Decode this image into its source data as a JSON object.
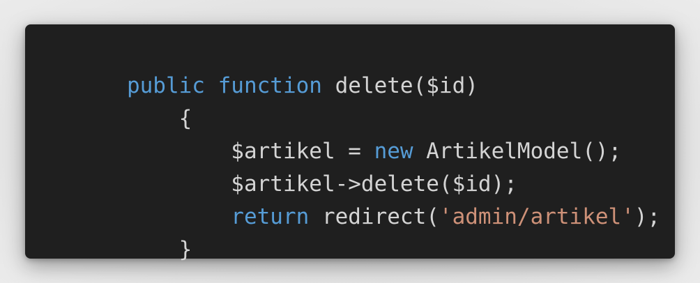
{
  "code": {
    "lines": [
      {
        "indent": "",
        "tokens": [
          {
            "text": "public",
            "type": "keyword"
          },
          {
            "text": " ",
            "type": "plain"
          },
          {
            "text": "function",
            "type": "keyword"
          },
          {
            "text": " delete($id)",
            "type": "plain"
          }
        ]
      },
      {
        "indent": "    ",
        "tokens": [
          {
            "text": "{",
            "type": "plain"
          }
        ]
      },
      {
        "indent": "        ",
        "tokens": [
          {
            "text": "$artikel = ",
            "type": "plain"
          },
          {
            "text": "new",
            "type": "keyword"
          },
          {
            "text": " ArtikelModel();",
            "type": "plain"
          }
        ]
      },
      {
        "indent": "        ",
        "tokens": [
          {
            "text": "$artikel->delete($id);",
            "type": "plain"
          }
        ]
      },
      {
        "indent": "        ",
        "tokens": [
          {
            "text": "return",
            "type": "keyword"
          },
          {
            "text": " redirect(",
            "type": "plain"
          },
          {
            "text": "'admin/artikel'",
            "type": "string"
          },
          {
            "text": ");",
            "type": "plain"
          }
        ]
      },
      {
        "indent": "    ",
        "tokens": [
          {
            "text": "}",
            "type": "plain"
          }
        ]
      }
    ]
  },
  "colors": {
    "background": "#1f1f1f",
    "keyword": "#569cd6",
    "string": "#ce9178",
    "plain": "#d4d4d4"
  }
}
